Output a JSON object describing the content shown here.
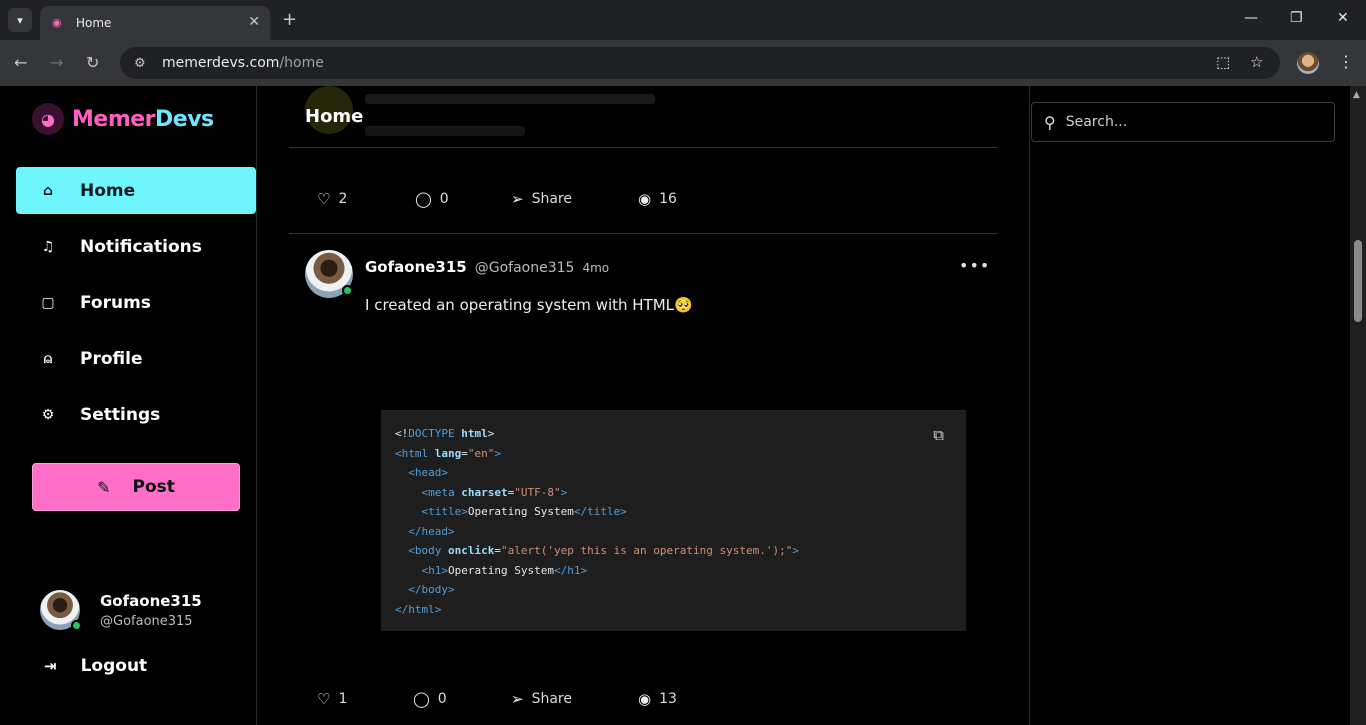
{
  "browser": {
    "tab_title": "Home",
    "url_domain": "memerdevs.com",
    "url_path": "/home"
  },
  "brand": {
    "name_part1": "Memer",
    "name_part2": "Devs"
  },
  "nav": {
    "items": [
      {
        "label": "Home",
        "icon": "home-icon",
        "active": true
      },
      {
        "label": "Notifications",
        "icon": "bell-icon",
        "active": false
      },
      {
        "label": "Forums",
        "icon": "chat-icon",
        "active": false
      },
      {
        "label": "Profile",
        "icon": "user-icon",
        "active": false
      },
      {
        "label": "Settings",
        "icon": "gear-icon",
        "active": false
      }
    ],
    "post_label": "Post",
    "logout_label": "Logout"
  },
  "current_user": {
    "name": "Gofaone315",
    "handle": "@Gofaone315"
  },
  "header": {
    "title": "Home"
  },
  "prev_post_actions": {
    "likes": "2",
    "comments": "0",
    "share": "Share",
    "views": "16"
  },
  "post": {
    "name": "Gofaone315",
    "handle": "@Gofaone315",
    "time": "4mo",
    "text": "I created an operating system with HTML🥺",
    "actions": {
      "likes": "1",
      "comments": "0",
      "share": "Share",
      "views": "13"
    }
  },
  "search": {
    "placeholder": "Search..."
  },
  "colors": {
    "accent_cyan": "#6ff5ff",
    "accent_pink": "#ff6ec7",
    "online": "#22c55e"
  }
}
